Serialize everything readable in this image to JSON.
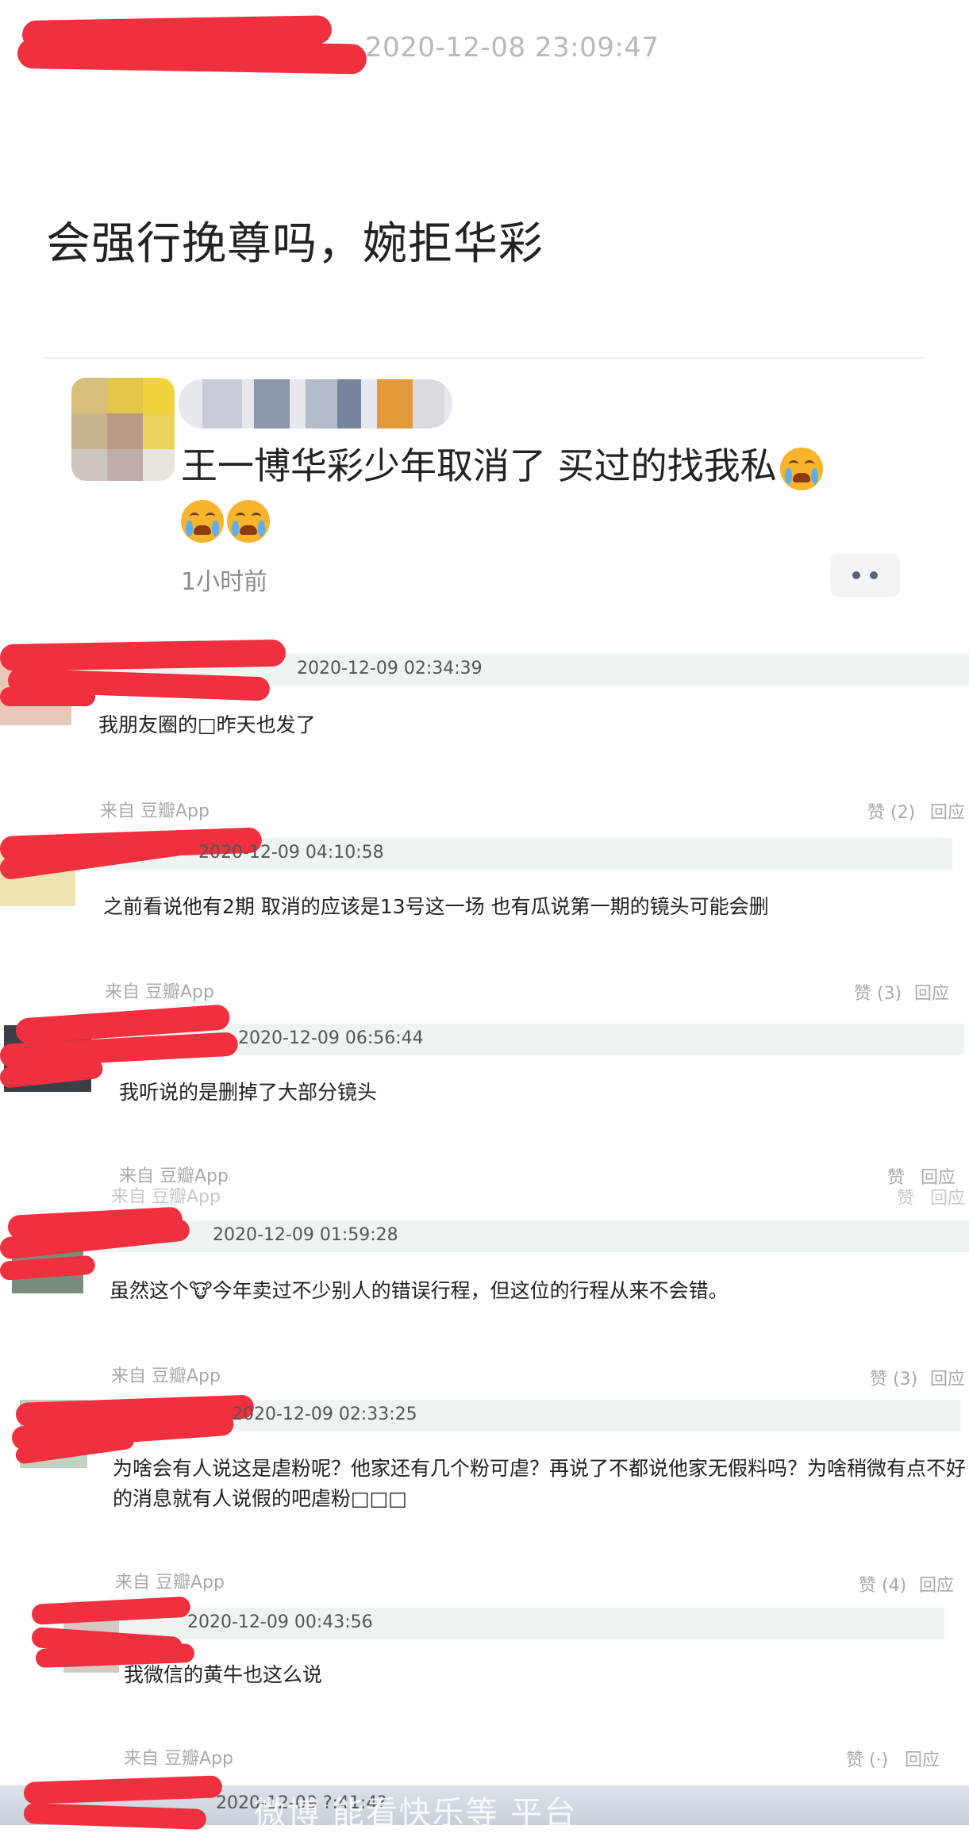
{
  "post": {
    "header_time": "2020-12-08 23:09:47",
    "title": "会强行挽尊吗，婉拒华彩"
  },
  "quoted": {
    "text": "王一博华彩少年取消了 买过的找我私",
    "emoji": "loudly-crying-face",
    "time": "1小时前"
  },
  "comments": [
    {
      "time": "2020-12-09 02:34:39",
      "text": "我朋友圈的□昨天也发了",
      "source": "来自 豆瓣App",
      "likes": "赞 (2)",
      "reply": "回应"
    },
    {
      "time": "2020-12-09 04:10:58",
      "text": "之前看说他有2期 取消的应该是13号这一场 也有瓜说第一期的镜头可能会删",
      "source": "来自 豆瓣App",
      "likes": "赞 (3)",
      "reply": "回应"
    },
    {
      "time": "2020-12-09 06:56:44",
      "text": "我听说的是删掉了大部分镜头",
      "source": "来自 豆瓣App",
      "likes": "赞",
      "reply": "回应"
    },
    {
      "time": "2020-12-09 01:59:28",
      "text": "虽然这个🐮今年卖过不少别人的错误行程，但这位的行程从来不会错。",
      "source": "来自 豆瓣App",
      "likes": "赞 (3)",
      "reply": "回应"
    },
    {
      "time": "2020-12-09 02:33:25",
      "text_line1": "为啥会有人说这是虐粉呢？他家还有几个粉可虐？再说了不都说他家无假料吗？为啥稍微有点不好",
      "text_line2": "的消息就有人说假的吧虐粉□□□",
      "source": "来自 豆瓣App",
      "likes": "赞 (4)",
      "reply": "回应"
    },
    {
      "time": "2020-12-09 00:43:56",
      "text": "我微信的黄牛也这么说",
      "source": "来自 豆瓣App",
      "likes": "赞 (·)",
      "reply": "回应"
    }
  ],
  "ghost": {
    "source": "来自 豆瓣App",
    "likes": "赞",
    "reply": "回应"
  },
  "last_time": "2020-12-09 ?:41:4?",
  "watermark": "微博 能看快乐等 平台",
  "colors": {
    "redaction": "#f0303f",
    "comment_bar": "#eef4f2",
    "muted": "#a9a9a9"
  }
}
